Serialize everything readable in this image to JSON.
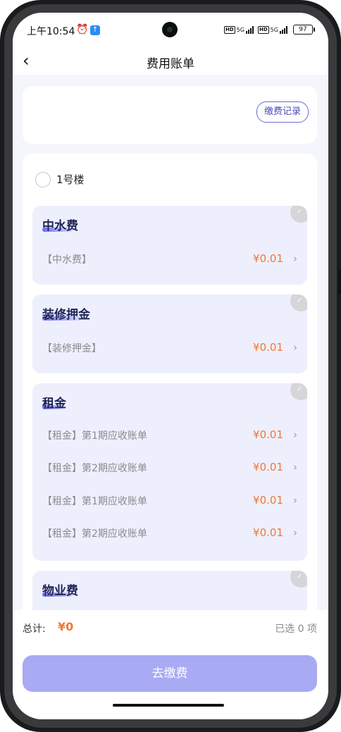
{
  "status_bar": {
    "time": "上午10:54",
    "alarm_icon": "alarm-icon",
    "network": "5G",
    "hd": "HD",
    "battery": "97"
  },
  "nav": {
    "back_icon": "back-arrow-icon",
    "title": "费用账单"
  },
  "record_button": "缴费记录",
  "building": {
    "name": "1号楼",
    "selected": false
  },
  "groups": [
    {
      "title": "中水费",
      "items": [
        {
          "label": "【中水费】",
          "amount": "¥0.01"
        }
      ]
    },
    {
      "title": "装修押金",
      "items": [
        {
          "label": "【装修押金】",
          "amount": "¥0.01"
        }
      ]
    },
    {
      "title": "租金",
      "items": [
        {
          "label": "【租金】第1期应收账单",
          "amount": "¥0.01"
        },
        {
          "label": "【租金】第2期应收账单",
          "amount": "¥0.01"
        },
        {
          "label": "【租金】第1期应收账单",
          "amount": "¥0.01"
        },
        {
          "label": "【租金】第2期应收账单",
          "amount": "¥0.01"
        }
      ]
    },
    {
      "title": "物业费",
      "items": []
    }
  ],
  "footer": {
    "total_label": "总计:",
    "total_value": "¥0",
    "selected_text": "已选 0 项",
    "pay_button": "去缴费"
  },
  "colors": {
    "accent": "#6b6bf0",
    "amount": "#f07833",
    "button": "#a9aaf4",
    "group_bg": "#eeeffd"
  }
}
